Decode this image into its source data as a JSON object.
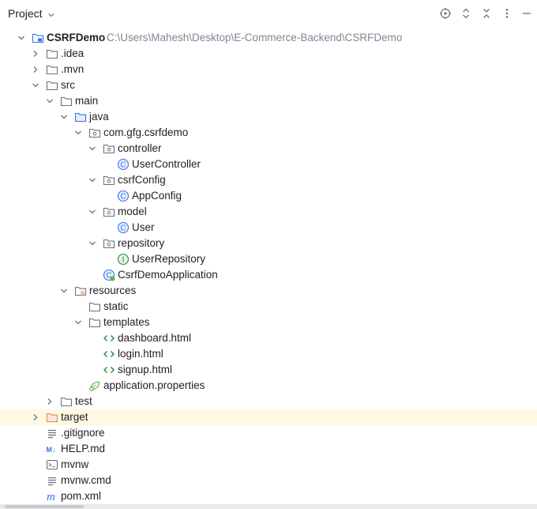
{
  "header": {
    "title": "Project"
  },
  "toolbar": {
    "icons": [
      "locate-icon",
      "expand-collapse-icon",
      "collapse-all-icon",
      "more-options-icon",
      "hide-icon"
    ]
  },
  "tree": [
    {
      "label": "CSRFDemo",
      "path": "C:\\Users\\Mahesh\\Desktop\\E-Commerce-Backend\\CSRFDemo",
      "icon": "module-folder",
      "state": "expanded"
    },
    {
      "label": ".idea",
      "icon": "folder",
      "state": "collapsed"
    },
    {
      "label": ".mvn",
      "icon": "folder",
      "state": "collapsed"
    },
    {
      "label": "src",
      "icon": "folder",
      "state": "expanded"
    },
    {
      "label": "main",
      "icon": "folder",
      "state": "expanded"
    },
    {
      "label": "java",
      "icon": "source-folder",
      "state": "expanded"
    },
    {
      "label": "com.gfg.csrfdemo",
      "icon": "package",
      "state": "expanded"
    },
    {
      "label": "controller",
      "icon": "package",
      "state": "expanded"
    },
    {
      "label": "UserController",
      "icon": "class",
      "state": "leaf"
    },
    {
      "label": "csrfConfig",
      "icon": "package",
      "state": "expanded"
    },
    {
      "label": "AppConfig",
      "icon": "class",
      "state": "leaf"
    },
    {
      "label": "model",
      "icon": "package",
      "state": "expanded"
    },
    {
      "label": "User",
      "icon": "class",
      "state": "leaf"
    },
    {
      "label": "repository",
      "icon": "package",
      "state": "expanded"
    },
    {
      "label": "UserRepository",
      "icon": "interface",
      "state": "leaf"
    },
    {
      "label": "CsrfDemoApplication",
      "icon": "spring-boot-class",
      "state": "leaf"
    },
    {
      "label": "resources",
      "icon": "resources-folder",
      "state": "expanded"
    },
    {
      "label": "static",
      "icon": "folder",
      "state": "leaf"
    },
    {
      "label": "templates",
      "icon": "folder",
      "state": "expanded"
    },
    {
      "label": "dashboard.html",
      "icon": "html",
      "state": "leaf"
    },
    {
      "label": "login.html",
      "icon": "html",
      "state": "leaf"
    },
    {
      "label": "signup.html",
      "icon": "html",
      "state": "leaf"
    },
    {
      "label": "application.properties",
      "icon": "spring-properties",
      "state": "leaf"
    },
    {
      "label": "test",
      "icon": "folder",
      "state": "collapsed"
    },
    {
      "label": "target",
      "icon": "excluded-folder",
      "state": "collapsed",
      "selected": true
    },
    {
      "label": ".gitignore",
      "icon": "text-file",
      "state": "leaf"
    },
    {
      "label": "HELP.md",
      "icon": "markdown",
      "state": "leaf"
    },
    {
      "label": "mvnw",
      "icon": "terminal",
      "state": "leaf"
    },
    {
      "label": "mvnw.cmd",
      "icon": "text-file",
      "state": "leaf"
    },
    {
      "label": "pom.xml",
      "icon": "maven",
      "state": "leaf"
    }
  ],
  "colors": {
    "selected_row": "#fdf9e3",
    "path_text": "#818594",
    "folder_stroke": "#6c707e",
    "source_folder": "#3574f0",
    "class_icon": "#3574f0",
    "interface_icon": "#208a3c",
    "excluded_folder": "#e08855"
  }
}
